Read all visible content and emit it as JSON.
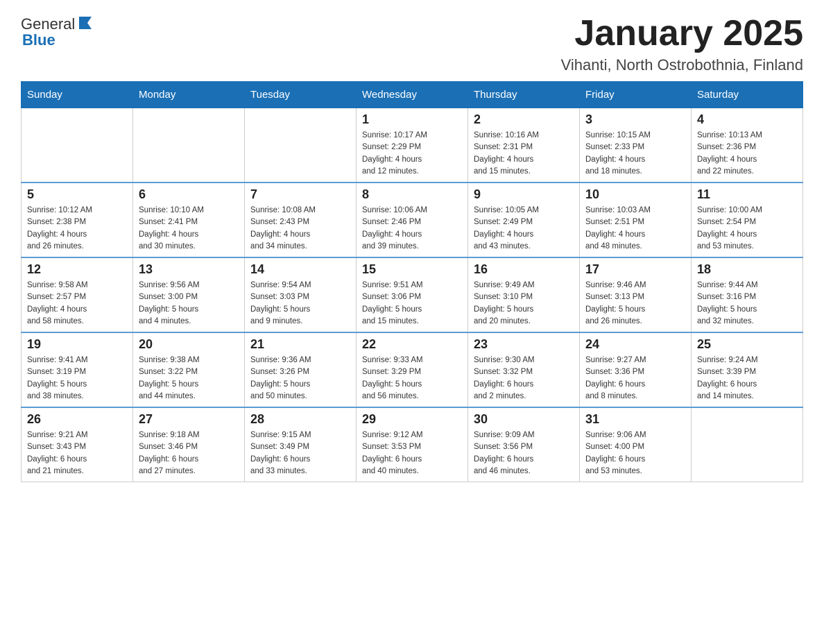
{
  "header": {
    "logo_text_general": "General",
    "logo_text_blue": "Blue",
    "month_title": "January 2025",
    "location": "Vihanti, North Ostrobothnia, Finland"
  },
  "weekdays": [
    "Sunday",
    "Monday",
    "Tuesday",
    "Wednesday",
    "Thursday",
    "Friday",
    "Saturday"
  ],
  "weeks": [
    [
      {
        "day": "",
        "info": ""
      },
      {
        "day": "",
        "info": ""
      },
      {
        "day": "",
        "info": ""
      },
      {
        "day": "1",
        "info": "Sunrise: 10:17 AM\nSunset: 2:29 PM\nDaylight: 4 hours\nand 12 minutes."
      },
      {
        "day": "2",
        "info": "Sunrise: 10:16 AM\nSunset: 2:31 PM\nDaylight: 4 hours\nand 15 minutes."
      },
      {
        "day": "3",
        "info": "Sunrise: 10:15 AM\nSunset: 2:33 PM\nDaylight: 4 hours\nand 18 minutes."
      },
      {
        "day": "4",
        "info": "Sunrise: 10:13 AM\nSunset: 2:36 PM\nDaylight: 4 hours\nand 22 minutes."
      }
    ],
    [
      {
        "day": "5",
        "info": "Sunrise: 10:12 AM\nSunset: 2:38 PM\nDaylight: 4 hours\nand 26 minutes."
      },
      {
        "day": "6",
        "info": "Sunrise: 10:10 AM\nSunset: 2:41 PM\nDaylight: 4 hours\nand 30 minutes."
      },
      {
        "day": "7",
        "info": "Sunrise: 10:08 AM\nSunset: 2:43 PM\nDaylight: 4 hours\nand 34 minutes."
      },
      {
        "day": "8",
        "info": "Sunrise: 10:06 AM\nSunset: 2:46 PM\nDaylight: 4 hours\nand 39 minutes."
      },
      {
        "day": "9",
        "info": "Sunrise: 10:05 AM\nSunset: 2:49 PM\nDaylight: 4 hours\nand 43 minutes."
      },
      {
        "day": "10",
        "info": "Sunrise: 10:03 AM\nSunset: 2:51 PM\nDaylight: 4 hours\nand 48 minutes."
      },
      {
        "day": "11",
        "info": "Sunrise: 10:00 AM\nSunset: 2:54 PM\nDaylight: 4 hours\nand 53 minutes."
      }
    ],
    [
      {
        "day": "12",
        "info": "Sunrise: 9:58 AM\nSunset: 2:57 PM\nDaylight: 4 hours\nand 58 minutes."
      },
      {
        "day": "13",
        "info": "Sunrise: 9:56 AM\nSunset: 3:00 PM\nDaylight: 5 hours\nand 4 minutes."
      },
      {
        "day": "14",
        "info": "Sunrise: 9:54 AM\nSunset: 3:03 PM\nDaylight: 5 hours\nand 9 minutes."
      },
      {
        "day": "15",
        "info": "Sunrise: 9:51 AM\nSunset: 3:06 PM\nDaylight: 5 hours\nand 15 minutes."
      },
      {
        "day": "16",
        "info": "Sunrise: 9:49 AM\nSunset: 3:10 PM\nDaylight: 5 hours\nand 20 minutes."
      },
      {
        "day": "17",
        "info": "Sunrise: 9:46 AM\nSunset: 3:13 PM\nDaylight: 5 hours\nand 26 minutes."
      },
      {
        "day": "18",
        "info": "Sunrise: 9:44 AM\nSunset: 3:16 PM\nDaylight: 5 hours\nand 32 minutes."
      }
    ],
    [
      {
        "day": "19",
        "info": "Sunrise: 9:41 AM\nSunset: 3:19 PM\nDaylight: 5 hours\nand 38 minutes."
      },
      {
        "day": "20",
        "info": "Sunrise: 9:38 AM\nSunset: 3:22 PM\nDaylight: 5 hours\nand 44 minutes."
      },
      {
        "day": "21",
        "info": "Sunrise: 9:36 AM\nSunset: 3:26 PM\nDaylight: 5 hours\nand 50 minutes."
      },
      {
        "day": "22",
        "info": "Sunrise: 9:33 AM\nSunset: 3:29 PM\nDaylight: 5 hours\nand 56 minutes."
      },
      {
        "day": "23",
        "info": "Sunrise: 9:30 AM\nSunset: 3:32 PM\nDaylight: 6 hours\nand 2 minutes."
      },
      {
        "day": "24",
        "info": "Sunrise: 9:27 AM\nSunset: 3:36 PM\nDaylight: 6 hours\nand 8 minutes."
      },
      {
        "day": "25",
        "info": "Sunrise: 9:24 AM\nSunset: 3:39 PM\nDaylight: 6 hours\nand 14 minutes."
      }
    ],
    [
      {
        "day": "26",
        "info": "Sunrise: 9:21 AM\nSunset: 3:43 PM\nDaylight: 6 hours\nand 21 minutes."
      },
      {
        "day": "27",
        "info": "Sunrise: 9:18 AM\nSunset: 3:46 PM\nDaylight: 6 hours\nand 27 minutes."
      },
      {
        "day": "28",
        "info": "Sunrise: 9:15 AM\nSunset: 3:49 PM\nDaylight: 6 hours\nand 33 minutes."
      },
      {
        "day": "29",
        "info": "Sunrise: 9:12 AM\nSunset: 3:53 PM\nDaylight: 6 hours\nand 40 minutes."
      },
      {
        "day": "30",
        "info": "Sunrise: 9:09 AM\nSunset: 3:56 PM\nDaylight: 6 hours\nand 46 minutes."
      },
      {
        "day": "31",
        "info": "Sunrise: 9:06 AM\nSunset: 4:00 PM\nDaylight: 6 hours\nand 53 minutes."
      },
      {
        "day": "",
        "info": ""
      }
    ]
  ]
}
